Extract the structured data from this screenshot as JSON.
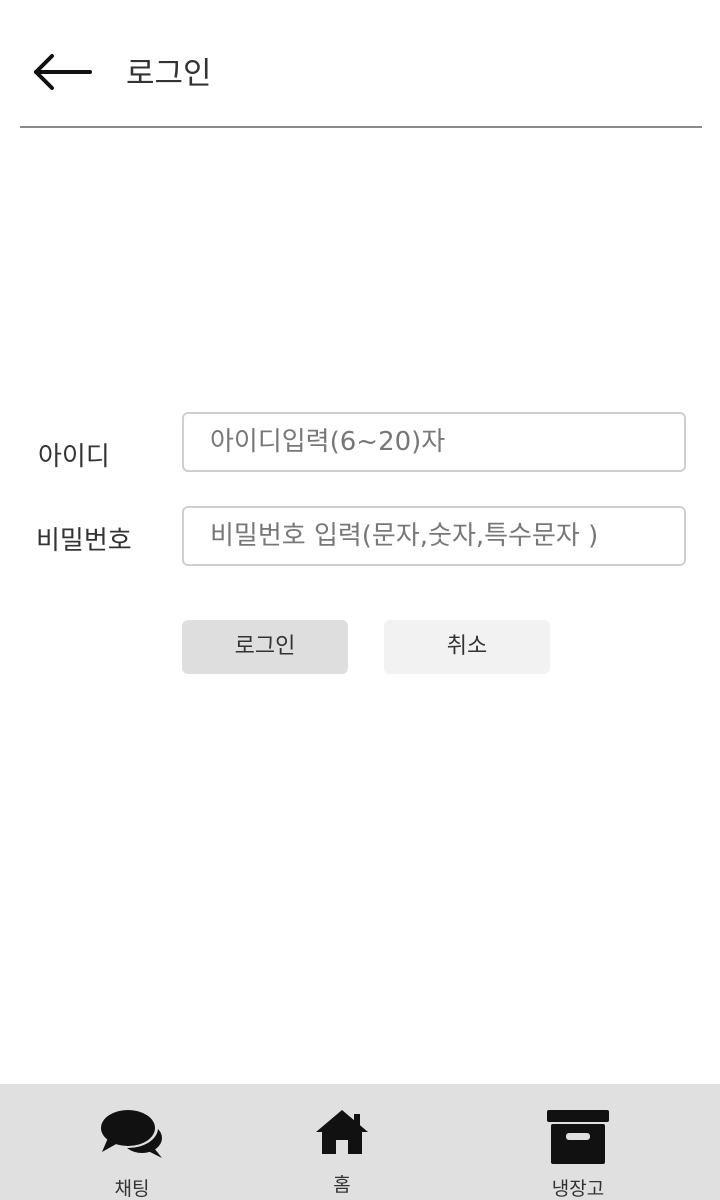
{
  "header": {
    "back_icon": "arrow-left-icon",
    "title": "로그인"
  },
  "form": {
    "id": {
      "label": "아이디",
      "placeholder": "아이디입력(6~20)자",
      "value": ""
    },
    "password": {
      "label": "비밀번호",
      "placeholder": "비밀번호 입력(문자,숫자,특수문자 )",
      "value": ""
    },
    "login_button": "로그인",
    "cancel_button": "취소"
  },
  "bottom_nav": {
    "items": [
      {
        "label": "채팅",
        "icon": "chat-bubbles-icon"
      },
      {
        "label": "홈",
        "icon": "home-icon"
      },
      {
        "label": "냉장고",
        "icon": "archive-box-icon"
      }
    ]
  },
  "colors": {
    "divider": "#8a8a8a",
    "input_border": "#cfcfcf",
    "login_button_bg": "#dedede",
    "cancel_button_bg": "#f2f2f2",
    "bottom_nav_bg": "#e0e0e0"
  }
}
